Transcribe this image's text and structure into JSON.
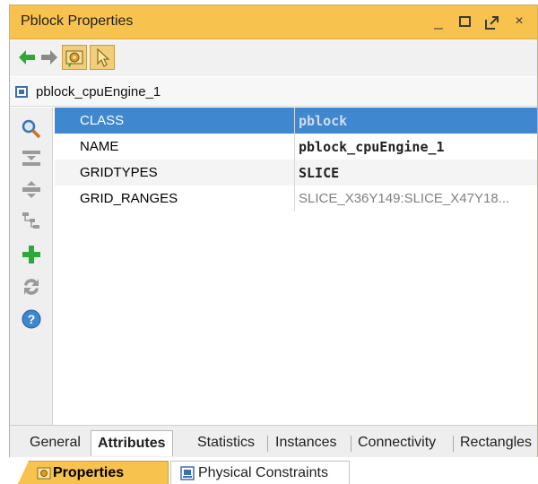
{
  "window": {
    "title": "Pblock Properties",
    "controls": {
      "minimize": "_",
      "close": "×"
    }
  },
  "toolbar": {
    "back_icon": "back-arrow-icon",
    "forward_icon": "forward-arrow-icon",
    "icons": [
      "back-arrow-icon",
      "forward-arrow-icon",
      "auto-update-icon",
      "select-cursor-icon"
    ]
  },
  "object": {
    "name": "pblock_cpuEngine_1"
  },
  "sidebar": {
    "icons": [
      "search-icon",
      "collapse-all-icon",
      "expand-all-icon",
      "group-by-icon",
      "add-icon",
      "refresh-icon",
      "help-icon"
    ]
  },
  "properties": [
    {
      "key": "CLASS",
      "value": "pblock"
    },
    {
      "key": "NAME",
      "value": "pblock_cpuEngine_1"
    },
    {
      "key": "GRIDTYPES",
      "value": "SLICE"
    },
    {
      "key": "GRID_RANGES",
      "value": "SLICE_X36Y149:SLICE_X47Y18..."
    }
  ],
  "tabs": [
    "General",
    "Attributes",
    "Statistics",
    "Instances",
    "Connectivity",
    "Rectangles"
  ],
  "active_tab": "Attributes",
  "bottom_tabs": [
    "Properties",
    "Physical Constraints"
  ],
  "active_bottom_tab": "Properties",
  "colors": {
    "title_bar": "#f8c24e",
    "selection": "#3f88cf",
    "green_icon": "#2fa83a"
  }
}
